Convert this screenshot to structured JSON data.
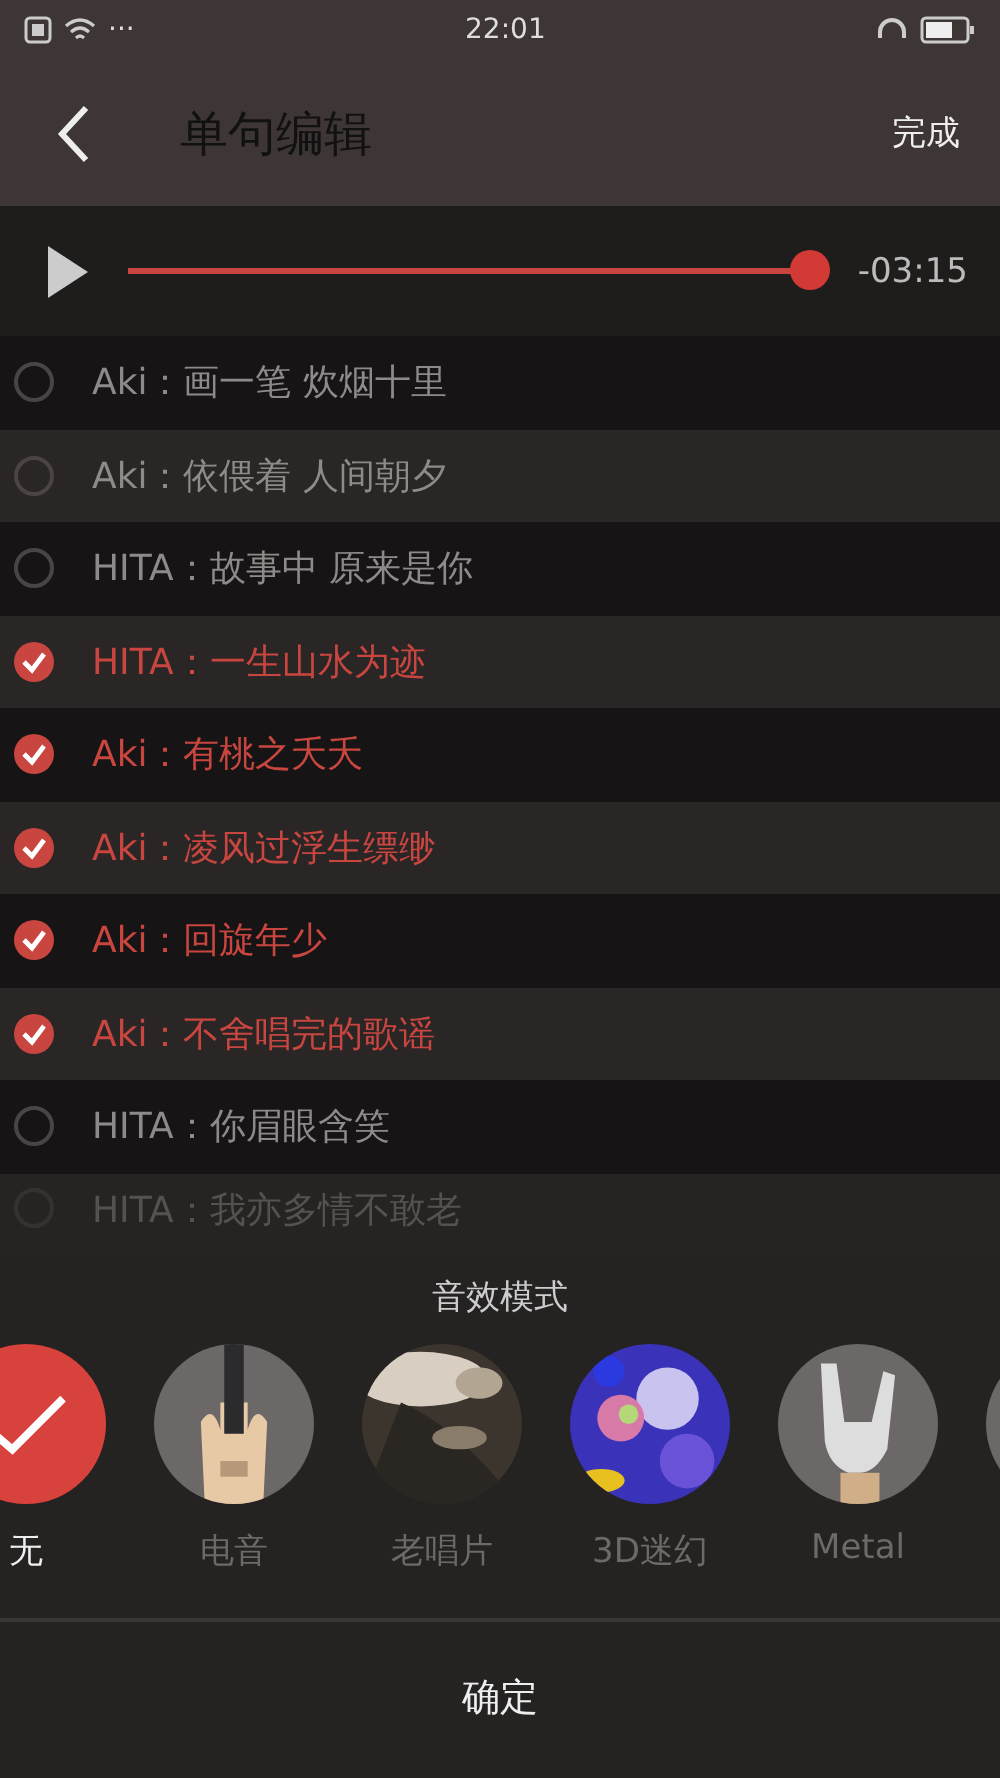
{
  "status_bar": {
    "time": "22:01",
    "dots": "···"
  },
  "header": {
    "title": "单句编辑",
    "done": "完成"
  },
  "player": {
    "level": 1,
    "time": "-03:15"
  },
  "lines": [
    {
      "text": "Aki：画一笔 炊烟十里",
      "checked": false
    },
    {
      "text": "Aki：依偎着 人间朝夕",
      "checked": false
    },
    {
      "text": "HITA：故事中 原来是你",
      "checked": false
    },
    {
      "text": "HITA：一生山水为迹",
      "checked": true
    },
    {
      "text": "Aki：有桃之夭夭",
      "checked": true
    },
    {
      "text": "Aki：凌风过浮生缥缈",
      "checked": true
    },
    {
      "text": "Aki：回旋年少",
      "checked": true
    },
    {
      "text": "Aki：不舍唱完的歌谣",
      "checked": true
    },
    {
      "text": "HITA：你眉眼含笑",
      "checked": false
    },
    {
      "text": "HITA：我亦多情不敢老",
      "checked": false
    }
  ],
  "effects": {
    "title": "音效模式",
    "items": [
      {
        "label": "无",
        "kind": "none",
        "selected": true
      },
      {
        "label": "电音",
        "kind": "guitar",
        "selected": false
      },
      {
        "label": "老唱片",
        "kind": "record",
        "selected": false
      },
      {
        "label": "3D迷幻",
        "kind": "bokeh",
        "selected": false
      },
      {
        "label": "Metal",
        "kind": "hand",
        "selected": false
      },
      {
        "kind": "plain",
        "selected": false
      }
    ]
  },
  "confirm": "确定"
}
